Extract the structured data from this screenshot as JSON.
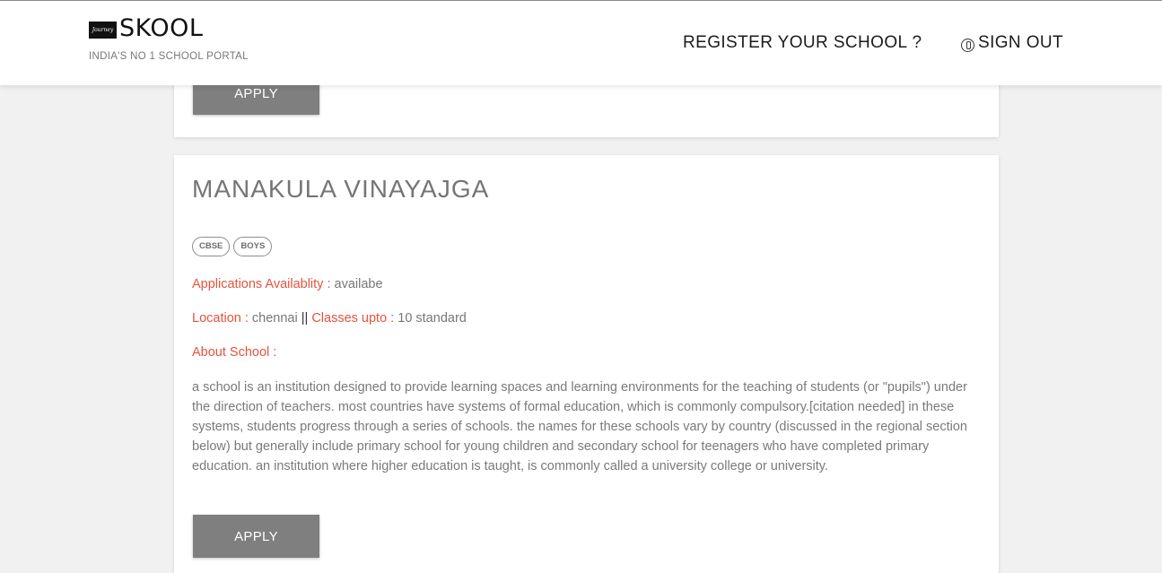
{
  "header": {
    "logo_badge": "Journey",
    "logo_text": "SKOOL",
    "tagline": "INDIA'S NO 1 SCHOOL PORTAL",
    "register_label": "REGISTER YOUR SCHOOL ?",
    "signout_label": "SIGN OUT",
    "signout_icon": "power-icon"
  },
  "cards": [
    {
      "apply_label": "APPLY"
    },
    {
      "name": "MANAKULA VINAYAJGA",
      "tags": [
        "CBSE",
        "BOYS"
      ],
      "availability_label": "Applications Availablity :",
      "availability_value": "availabe",
      "location_label": "Location :",
      "location_value": "chennai",
      "separator": "||",
      "classes_label": "Classes upto :",
      "classes_value": "10 standard",
      "about_label": "About School :",
      "about_text": "a school is an institution designed to provide learning spaces and learning environments for the teaching of students (or \"pupils\") under the direction of teachers. most countries have systems of formal education, which is commonly compulsory.[citation needed] in these systems, students progress through a series of schools. the names for these schools vary by country (discussed in the regional section below) but generally include primary school for young children and secondary school for teenagers who have completed primary education. an institution where higher education is taught, is commonly called a university college or university.",
      "apply_label": "APPLY"
    }
  ],
  "colors": {
    "accent": "#e4533d",
    "button": "#7f7f7f",
    "background": "#f1f1f1"
  }
}
